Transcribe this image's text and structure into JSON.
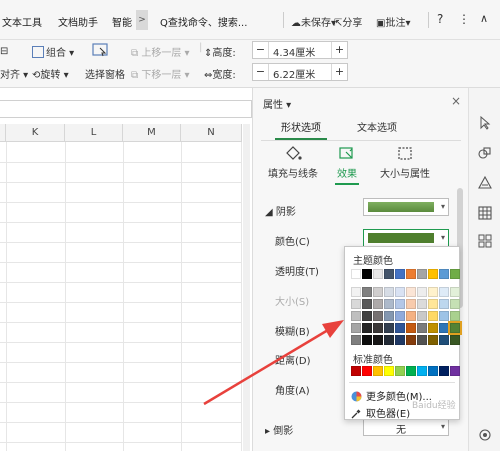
{
  "topbar": {
    "tabs": [
      "文本工具",
      "文档助手",
      "智能"
    ],
    "more": ">",
    "search": "Q查找命令、搜索...",
    "unsaved": "未保存",
    "share": "分享",
    "review": "批注",
    "help": "?",
    "kebab": "⋮",
    "collapse": "∧"
  },
  "ribbon": {
    "group": "组合",
    "rotate": "旋转",
    "align": "对齐",
    "select_pane": "选择窗格",
    "bring_forward": "上移一层",
    "send_backward": "下移一层",
    "height_label": "高度:",
    "height_value": "4.34厘米",
    "width_label": "宽度:",
    "width_value": "6.22厘米",
    "minus": "−",
    "plus": "+"
  },
  "sheet": {
    "columns": [
      "K",
      "L",
      "M",
      "N"
    ]
  },
  "panel": {
    "title": "属性",
    "close": "×",
    "tabs": [
      "形状选项",
      "文本选项"
    ],
    "subtabs": [
      "填充与线条",
      "效果",
      "大小与属性"
    ],
    "section_shadow": "阴影",
    "section_reflection": "倒影",
    "props": [
      "颜色(C)",
      "透明度(T)",
      "大小(S)",
      "模糊(B)",
      "距离(D)",
      "角度(A)"
    ],
    "reflection_value": "无"
  },
  "popup": {
    "theme_label": "主题颜色",
    "standard_label": "标准颜色",
    "more_colors": "更多颜色(M)...",
    "eyedropper": "取色器(E)",
    "theme_top": [
      "#ffffff",
      "#000000",
      "#e7e6e6",
      "#44546a",
      "#4472c4",
      "#ed7d31",
      "#a5a5a5",
      "#ffc000",
      "#5b9bd5",
      "#70ad47"
    ],
    "theme_shades": [
      [
        "#f2f2f2",
        "#808080",
        "#d0cece",
        "#d6dce5",
        "#d9e2f3",
        "#fbe5d6",
        "#ededed",
        "#fff2cc",
        "#deebf7",
        "#e2f0d9"
      ],
      [
        "#d9d9d9",
        "#595959",
        "#aeaaaa",
        "#adb9ca",
        "#b4c7e7",
        "#f8cbad",
        "#dbdbdb",
        "#ffe699",
        "#bdd7ee",
        "#c5e0b4"
      ],
      [
        "#bfbfbf",
        "#404040",
        "#767171",
        "#8497b0",
        "#8faadc",
        "#f4b183",
        "#c9c9c9",
        "#ffd966",
        "#9dc3e6",
        "#a9d18e"
      ],
      [
        "#a6a6a6",
        "#262626",
        "#3b3838",
        "#333f50",
        "#2f5597",
        "#c55a11",
        "#7b7b7b",
        "#bf9000",
        "#2e75b6",
        "#548235"
      ],
      [
        "#7f7f7f",
        "#0d0d0d",
        "#171616",
        "#222a35",
        "#1f3864",
        "#843c0c",
        "#525252",
        "#7f6000",
        "#1f4e79",
        "#385723"
      ]
    ],
    "standard": [
      "#c00000",
      "#ff0000",
      "#ffc000",
      "#ffff00",
      "#92d050",
      "#00b050",
      "#00b0f0",
      "#0070c0",
      "#002060",
      "#7030a0"
    ]
  },
  "colors": {
    "shadow_swatch": "#5a8a3c",
    "color_swatch": "#4f7f2e",
    "accent_green": "#1f9a4f",
    "arrow": "#e8413c"
  },
  "watermark": "Baidu经验"
}
